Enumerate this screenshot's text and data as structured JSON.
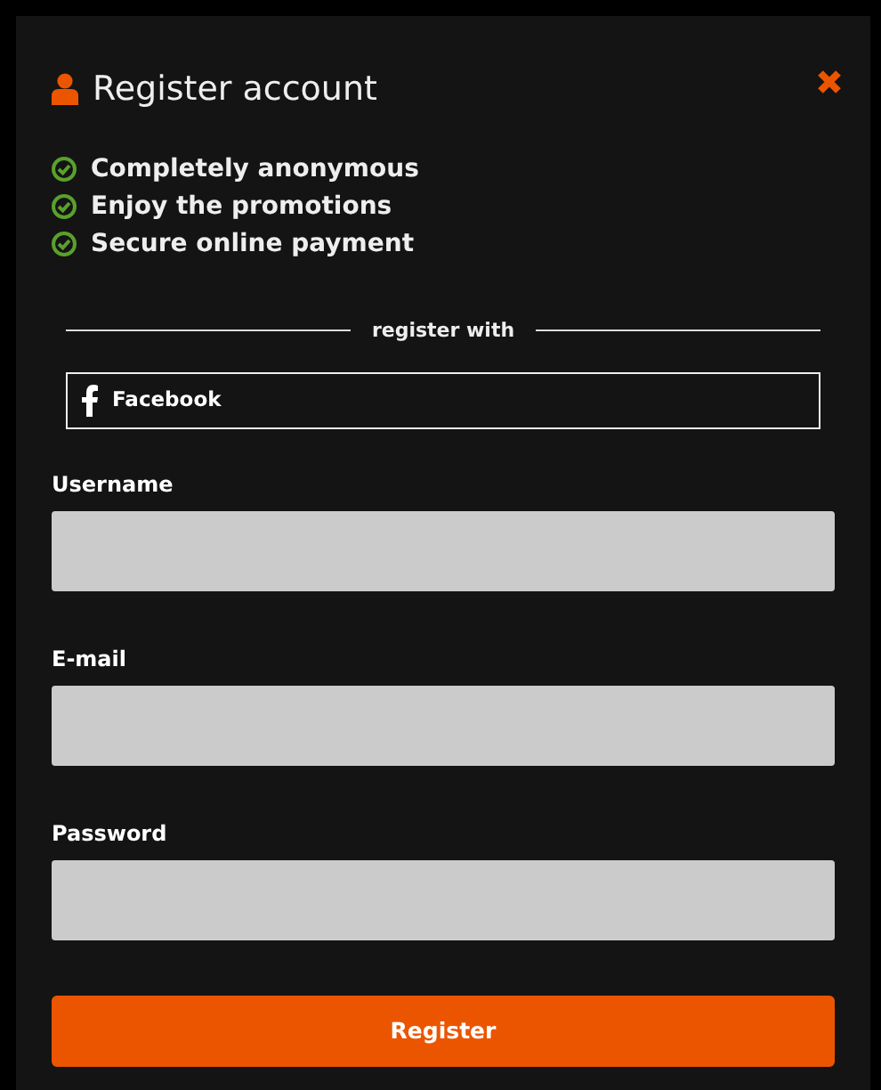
{
  "dialog": {
    "title": "Register account"
  },
  "features": [
    "Completely anonymous",
    "Enjoy the promotions",
    "Secure online payment"
  ],
  "divider_label": "register with",
  "social_buttons": [
    {
      "label": "Facebook"
    }
  ],
  "fields": [
    {
      "label": "Username"
    },
    {
      "label": "E-mail"
    },
    {
      "label": "Password"
    }
  ],
  "submit": "Register"
}
